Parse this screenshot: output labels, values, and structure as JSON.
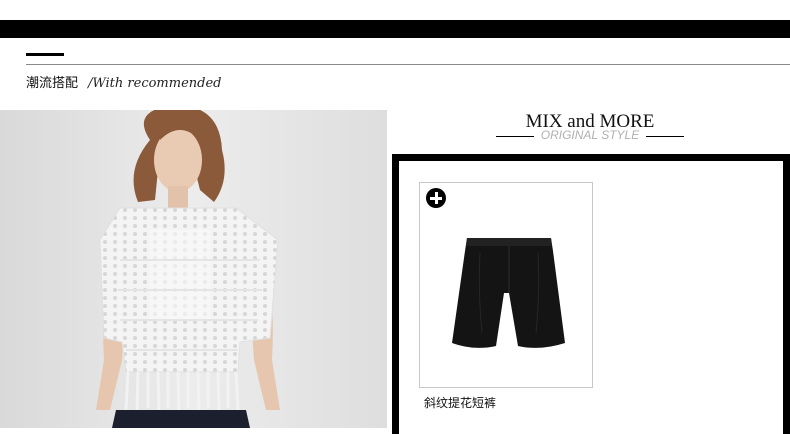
{
  "section": {
    "title": "潮流搭配",
    "subtitle": "/With recommended"
  },
  "mix": {
    "title": "MIX and MORE",
    "subtitle": "ORIGINAL STYLE"
  },
  "product": {
    "name": "斜纹提花短裤",
    "add_icon": "plus-circle-icon"
  },
  "colors": {
    "bar": "#000000",
    "subtitle_gray": "#b0b0b0",
    "card_border": "#c8c8c8"
  }
}
